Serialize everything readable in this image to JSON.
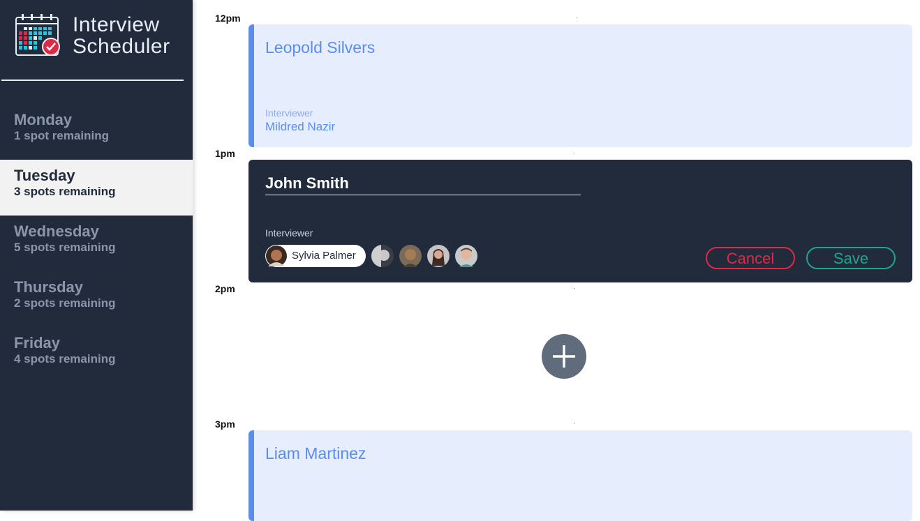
{
  "app": {
    "title_line1": "Interview",
    "title_line2": "Scheduler",
    "logo_icon": "calendar-check-icon"
  },
  "days": [
    {
      "name": "Monday",
      "spots": "1 spot remaining",
      "selected": false
    },
    {
      "name": "Tuesday",
      "spots": "3 spots remaining",
      "selected": true
    },
    {
      "name": "Wednesday",
      "spots": "5 spots remaining",
      "selected": false
    },
    {
      "name": "Thursday",
      "spots": "2 spots remaining",
      "selected": false
    },
    {
      "name": "Friday",
      "spots": "4 spots remaining",
      "selected": false
    }
  ],
  "times": [
    "12pm",
    "1pm",
    "2pm",
    "3pm"
  ],
  "appointments": [
    {
      "time": "12pm",
      "student": "Leopold Silvers",
      "interviewer_label": "Interviewer",
      "interviewer": "Mildred Nazir"
    },
    {
      "time": "3pm",
      "student": "Liam Martinez"
    }
  ],
  "form": {
    "time": "1pm",
    "student_value": "John Smith",
    "interviewer_label": "Interviewer",
    "selected_interviewer": "Sylvia Palmer",
    "cancel_label": "Cancel",
    "save_label": "Save"
  },
  "add_button": {
    "icon": "plus-icon"
  },
  "colors": {
    "sidebar_bg": "#222b3c",
    "appointment_bg": "#e6edfd",
    "appointment_accent": "#5b8def",
    "cancel": "#e02a45",
    "save": "#1aa88a"
  }
}
